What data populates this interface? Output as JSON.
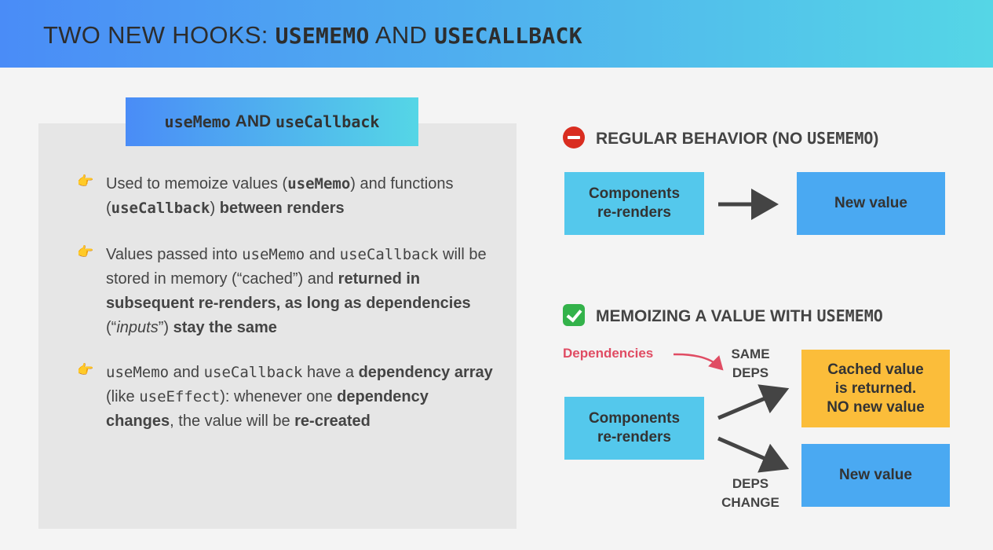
{
  "header": {
    "title_prefix": "TWO NEW HOOKS: ",
    "title_hook1": "USEMEMO",
    "title_and": " AND ",
    "title_hook2": "USECALLBACK"
  },
  "panel": {
    "tag_hook1": "useMemo",
    "tag_and": " AND ",
    "tag_hook2": "useCallback",
    "bullets": [
      {
        "parts": [
          "Used to memoize values (",
          "useMemo",
          ") and functions (",
          "useCallback",
          ") ",
          "between renders"
        ]
      },
      {
        "parts": [
          "Values passed into ",
          "useMemo",
          " and ",
          "useCallback",
          " will be stored in memory (“cached”) and ",
          "returned in subsequent re-renders, as long as dependencies",
          " (“",
          "inputs",
          "”) ",
          "stay the same"
        ]
      },
      {
        "parts": [
          "useMemo",
          " and ",
          "useCallback",
          " have a ",
          "dependency array",
          " (like ",
          "useEffect",
          "): whenever one ",
          "dependency changes",
          ", the value will be ",
          "re-created"
        ]
      }
    ]
  },
  "regular": {
    "heading_text": "REGULAR BEHAVIOR (NO ",
    "heading_mono": "USEMEMO",
    "heading_end": ")",
    "box_left": "Components re-renders",
    "box_right": "New value"
  },
  "memo": {
    "heading_text": "MEMOIZING A VALUE WITH ",
    "heading_mono": "USEMEMO",
    "dependencies": "Dependencies",
    "same_deps_1": "SAME",
    "same_deps_2": "DEPS",
    "deps_change_1": "DEPS",
    "deps_change_2": "CHANGE",
    "box_left": "Components re-renders",
    "box_cached_1": "Cached value",
    "box_cached_2": "is returned.",
    "box_cached_3": "NO new value",
    "box_new": "New value"
  },
  "colors": {
    "gradient_start": "#4a8cf7",
    "gradient_end": "#55d6e6",
    "cyan_box": "#54c8ec",
    "blue_box": "#4aa9f2",
    "yellow_box": "#fbbd3a",
    "dependencies_red": "#e04c63"
  },
  "icons": {
    "bullet": "pointing-hand-icon",
    "regular": "no-entry-icon",
    "memo": "check-mark-icon"
  }
}
